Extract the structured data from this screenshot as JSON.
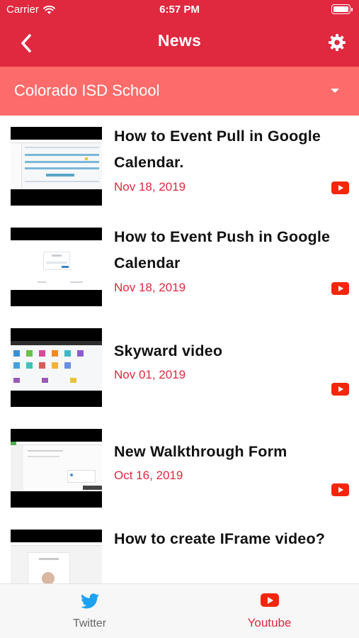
{
  "status_bar": {
    "carrier": "Carrier",
    "time": "6:57 PM"
  },
  "nav": {
    "title": "News"
  },
  "school_selector": {
    "selected": "Colorado ISD School"
  },
  "news": [
    {
      "title": "How to Event  Pull in Google Calendar.",
      "date": "Nov 18, 2019"
    },
    {
      "title": "How to Event Push in Google Calendar",
      "date": "Nov 18, 2019"
    },
    {
      "title": "Skyward video",
      "date": "Nov 01, 2019"
    },
    {
      "title": "New Walkthrough Form",
      "date": "Oct 16, 2019"
    },
    {
      "title": "How to create IFrame video?",
      "date": ""
    }
  ],
  "tabs": [
    {
      "label": "Twitter",
      "icon": "twitter-icon"
    },
    {
      "label": "Youtube",
      "icon": "youtube-icon"
    }
  ],
  "colors": {
    "header": "#e0283f",
    "dropdown": "#fd6b6b",
    "date": "#e0283f",
    "youtube": "#f4260c",
    "twitter": "#1da1f2"
  }
}
